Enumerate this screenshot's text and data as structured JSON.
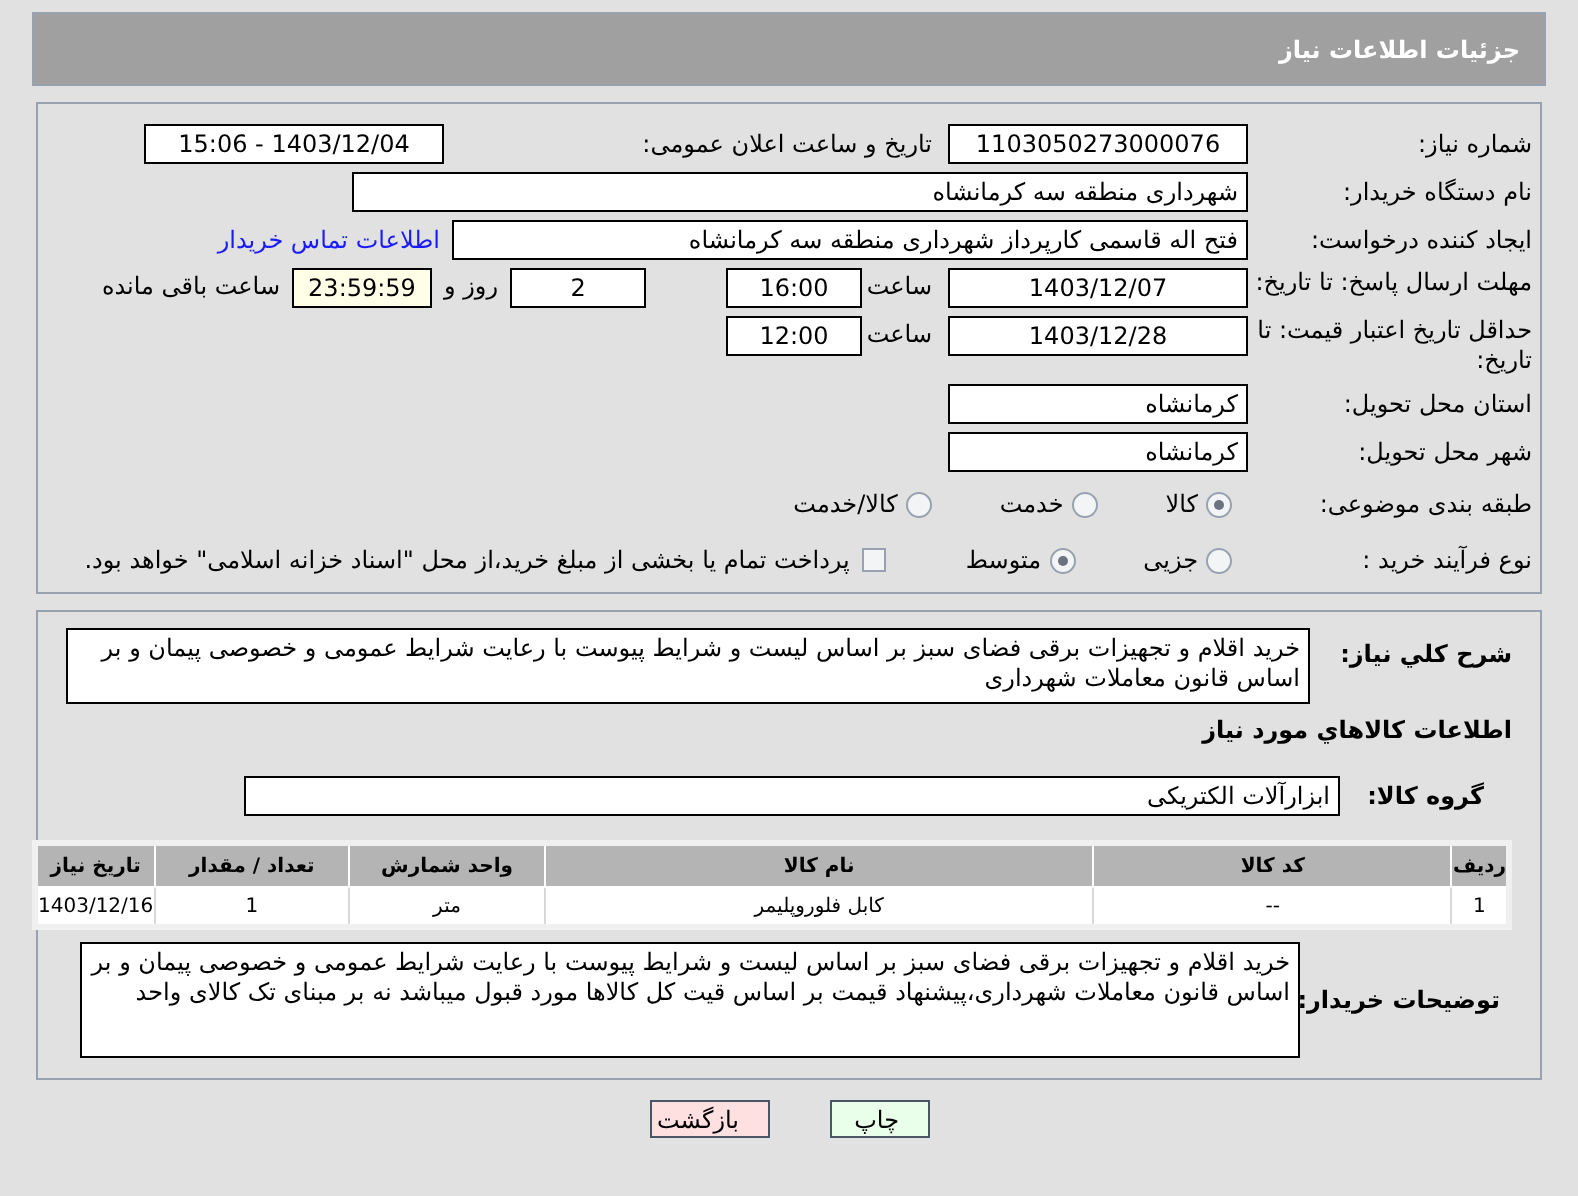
{
  "header": {
    "title": "جزئیات اطلاعات نیاز"
  },
  "need_number": {
    "label": "شماره نیاز:",
    "value": "1103050273000076"
  },
  "announce": {
    "label": "تاریخ و ساعت اعلان عمومی:",
    "value": "1403/12/04 - 15:06"
  },
  "buyer_org": {
    "label": "نام دستگاه خریدار:",
    "value": "شهرداری منطقه سه کرمانشاه"
  },
  "requester": {
    "label": "ایجاد کننده درخواست:",
    "value": "فتح اله قاسمی کارپرداز شهرداری منطقه سه کرمانشاه",
    "link": "اطلاعات تماس خریدار"
  },
  "reply_deadline": {
    "label": "مهلت ارسال پاسخ: تا تاریخ:",
    "date": "1403/12/07",
    "time_label": "ساعت",
    "time": "16:00",
    "days": "2",
    "days_label": "روز و",
    "remaining": "23:59:59",
    "remaining_label": "ساعت باقی مانده"
  },
  "price_validity": {
    "label": "حداقل تاریخ اعتبار قیمت: تا تاریخ:",
    "date": "1403/12/28",
    "time_label": "ساعت",
    "time": "12:00"
  },
  "province": {
    "label": "استان محل تحویل:",
    "value": "کرمانشاه"
  },
  "city": {
    "label": "شهر محل تحویل:",
    "value": "کرمانشاه"
  },
  "category": {
    "label": "طبقه بندی موضوعی:",
    "options": [
      {
        "label": "کالا",
        "selected": true
      },
      {
        "label": "خدمت",
        "selected": false
      },
      {
        "label": "کالا/خدمت",
        "selected": false
      }
    ]
  },
  "process": {
    "label": "نوع فرآیند خرید :",
    "options": [
      {
        "label": "جزیی",
        "selected": false
      },
      {
        "label": "متوسط",
        "selected": true
      }
    ],
    "treasury": {
      "label": "پرداخت تمام یا بخشی از مبلغ خرید،از محل \"اسناد خزانه اسلامی\" خواهد بود.",
      "checked": false
    }
  },
  "summary": {
    "label": "شرح کلي نياز:",
    "value": "خرید اقلام و تجهیزات برقی فضای سبز بر اساس لیست و شرایط پیوست با رعایت شرایط عمومی و خصوصی پیمان و بر اساس قانون معاملات شهرداری"
  },
  "goods_heading": "اطلاعات کالاهاي مورد نياز",
  "goods_group": {
    "label": "گروه کالا:",
    "value": "ابزارآلات الکتریکی"
  },
  "table": {
    "columns": [
      "ردیف",
      "کد کالا",
      "نام کالا",
      "واحد شمارش",
      "تعداد / مقدار",
      "تاریخ نیاز"
    ],
    "rows": [
      [
        "1",
        "--",
        "کابل فلوروپلیمر",
        "متر",
        "1",
        "1403/12/16"
      ]
    ]
  },
  "buyer_notes": {
    "label": "توضیحات خریدار:",
    "value": "خرید اقلام و تجهیزات برقی فضای سبز بر اساس لیست و شرایط پیوست با رعایت شرایط عمومی و خصوصی پیمان و بر اساس قانون معاملات شهرداری،پیشنهاد قیمت بر اساس قیت کل کالاها مورد قبول میباشد نه بر مبنای تک کالای واحد"
  },
  "buttons": [
    {
      "label": "چاپ",
      "kind": "print"
    },
    {
      "label": "بازگشت",
      "kind": "back"
    }
  ]
}
